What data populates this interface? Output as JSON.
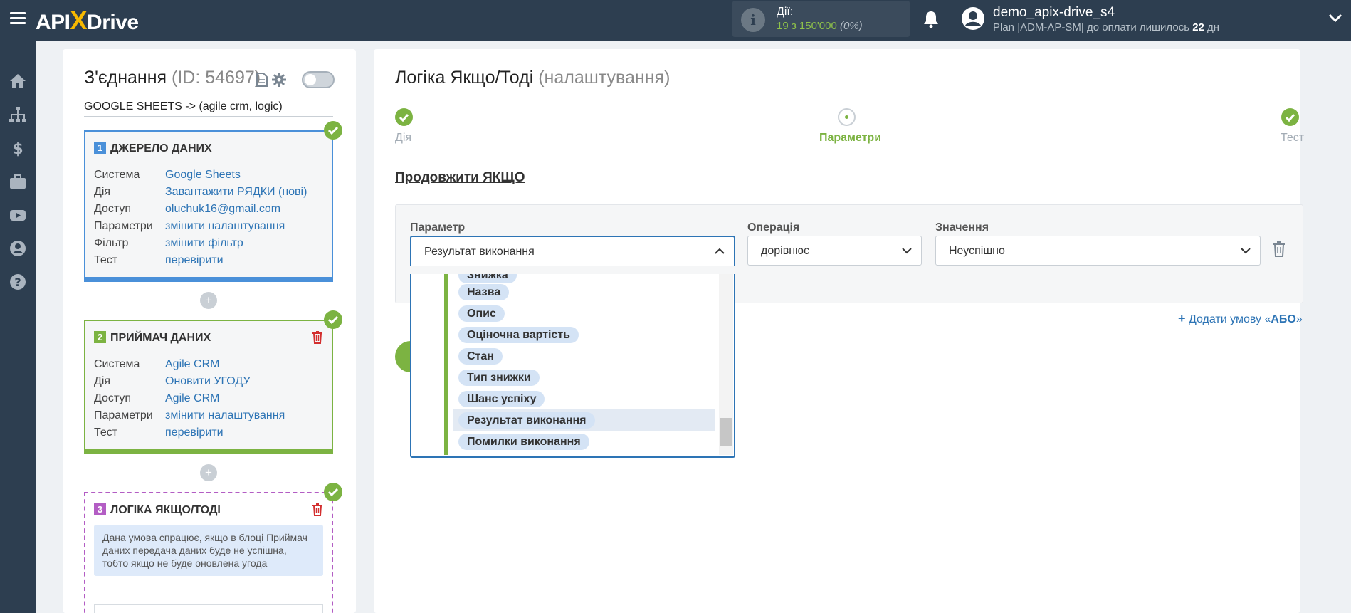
{
  "brand": {
    "logo_api": "API",
    "logo_x": "X",
    "logo_drive": "Drive"
  },
  "header": {
    "actions_label": "Дії:",
    "actions_value": "19 з 150'000",
    "actions_pct": "(0%)",
    "user_name": "demo_apix-drive_s4",
    "plan_prefix": "Plan |ADM-AP-SM| до оплати лишилось",
    "plan_days": "22",
    "plan_suffix": "дн"
  },
  "left": {
    "title": "З'єднання",
    "id_text": "(ID: 54697)",
    "connection_name": "GOOGLE SHEETS -> (agile crm, logic)",
    "blocks": [
      {
        "num": "1",
        "heading": "ДЖЕРЕЛО ДАНИХ",
        "rows": [
          {
            "k": "Система",
            "v": "Google Sheets"
          },
          {
            "k": "Дія",
            "v": "Завантажити РЯДКИ (нові)"
          },
          {
            "k": "Доступ",
            "v": "oluchuk16@gmail.com"
          },
          {
            "k": "Параметри",
            "v": "змінити налаштування"
          },
          {
            "k": "Фільтр",
            "v": "змінити фільтр"
          },
          {
            "k": "Тест",
            "v": "перевірити"
          }
        ]
      },
      {
        "num": "2",
        "heading": "ПРИЙМАЧ ДАНИХ",
        "rows": [
          {
            "k": "Система",
            "v": "Agile CRM"
          },
          {
            "k": "Дія",
            "v": "Оновити УГОДУ"
          },
          {
            "k": "Доступ",
            "v": "Agile CRM"
          },
          {
            "k": "Параметри",
            "v": "змінити налаштування"
          },
          {
            "k": "Тест",
            "v": "перевірити"
          }
        ]
      },
      {
        "num": "3",
        "heading": "ЛОГІКА ЯКЩО/ТОДІ",
        "description": "Дана умова спрацює, якщо в блоці Приймач даних передача даних буде не успішна, тобто якщо не буде оновлена угода"
      }
    ],
    "plus": "+"
  },
  "main": {
    "title": "Логіка Якщо/Тоді",
    "title_sub": "(налаштування)",
    "steps": [
      {
        "label": "Дія",
        "state": "done"
      },
      {
        "label": "Параметри",
        "state": "current"
      },
      {
        "label": "Тест",
        "state": "done"
      }
    ],
    "section_title": "Продовжити ЯКЩО",
    "condition": {
      "param_label": "Параметр",
      "param_value": "Результат виконання",
      "op_label": "Операція",
      "op_value": "дорівнює",
      "val_label": "Значення",
      "val_value": "Неуспішно"
    },
    "add_or_prefix": "Додати умову «",
    "add_or_bold": "АБО",
    "add_or_suffix": "»",
    "dropdown_items": [
      {
        "label": "Знижка",
        "selected": false
      },
      {
        "label": "Назва",
        "selected": false
      },
      {
        "label": "Опис",
        "selected": false
      },
      {
        "label": "Оціночна вартість",
        "selected": false
      },
      {
        "label": "Стан",
        "selected": false
      },
      {
        "label": "Тип знижки",
        "selected": false
      },
      {
        "label": "Шанс успіху",
        "selected": false
      },
      {
        "label": "Результат виконання",
        "selected": true
      },
      {
        "label": "Помилки виконання",
        "selected": false
      }
    ]
  },
  "colors": {
    "topbar": "#2d3e50",
    "green": "#7cb342",
    "blue": "#4a90d9",
    "purple": "#b35dc4",
    "link": "#2d74b5"
  }
}
